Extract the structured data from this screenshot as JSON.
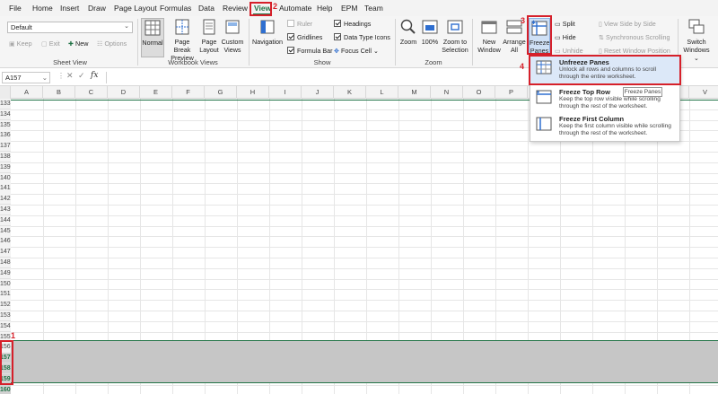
{
  "menu": {
    "tabs": [
      "File",
      "Home",
      "Insert",
      "Draw",
      "Page Layout",
      "Formulas",
      "Data",
      "Review",
      "View",
      "Automate",
      "Help",
      "EPM",
      "Team"
    ],
    "active_tab": "View"
  },
  "ribbon": {
    "sheet_view": {
      "dropdown_value": "Default",
      "keep": "Keep",
      "exit": "Exit",
      "new": "New",
      "options": "Options",
      "label": "Sheet View"
    },
    "workbook_views": {
      "normal": "Normal",
      "page_break_preview": "Page Break Preview",
      "page_layout": "Page Layout",
      "custom_views": "Custom Views",
      "label": "Workbook Views"
    },
    "show": {
      "navigation": "Navigation",
      "ruler": "Ruler",
      "gridlines": "Gridlines",
      "formula_bar": "Formula Bar",
      "headings": "Headings",
      "data_type_icons": "Data Type Icons",
      "focus_cell": "Focus Cell",
      "label": "Show"
    },
    "zoom": {
      "zoom": "Zoom",
      "hundred": "100%",
      "zoom_to_selection": "Zoom to Selection",
      "label": "Zoom"
    },
    "window": {
      "new_window": "New Window",
      "arrange_all": "Arrange All",
      "freeze_panes": "Freeze Panes",
      "split": "Split",
      "hide": "Hide",
      "unhide": "Unhide",
      "view_side_by_side": "View Side by Side",
      "synchronous_scrolling": "Synchronous Scrolling",
      "reset_window_position": "Reset Window Position",
      "switch_windows": "Switch Windows"
    }
  },
  "formula_bar": {
    "name_box": "A157",
    "fx": "fx",
    "value": ""
  },
  "grid": {
    "columns": [
      "A",
      "B",
      "C",
      "D",
      "E",
      "F",
      "G",
      "H",
      "I",
      "J",
      "K",
      "L",
      "M",
      "N",
      "O",
      "P",
      "Q",
      "R",
      "S",
      "T",
      "U",
      "V"
    ],
    "rows": [
      "133",
      "134",
      "135",
      "136",
      "137",
      "138",
      "139",
      "140",
      "141",
      "142",
      "143",
      "144",
      "145",
      "146",
      "147",
      "148",
      "149",
      "150",
      "151",
      "152",
      "153",
      "154",
      "155",
      "156",
      "157",
      "158",
      "159",
      "160",
      "161"
    ],
    "selected_rows": [
      "157",
      "158",
      "159",
      "160"
    ]
  },
  "freeze_menu": {
    "unfreeze": {
      "title": "Unfreeze Panes",
      "desc": "Unlock all rows and columns to scroll through the entire worksheet."
    },
    "top_row": {
      "title": "Freeze Top Row",
      "desc": "Keep the top row visible while scrolling through the rest of the worksheet."
    },
    "first_column": {
      "title": "Freeze First Column",
      "desc": "Keep the first column visible while scrolling through the rest of the worksheet."
    },
    "tooltip": "Freeze Panes"
  },
  "annotations": {
    "step1": "1",
    "step2": "2",
    "step3": "3",
    "step4": "4",
    "color": "#d6202a"
  },
  "colors": {
    "accent_green": "#217346",
    "selection_fill": "#c6c6c6"
  }
}
